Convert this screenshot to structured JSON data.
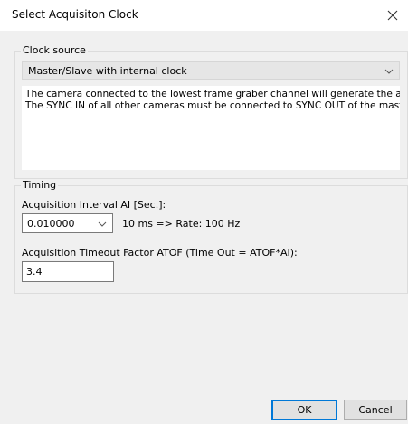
{
  "window": {
    "title": "Select Acquisiton Clock",
    "close_icon": "close-icon"
  },
  "clock_source": {
    "group_label": "Clock source",
    "selected": "Master/Slave with internal clock",
    "description_line1": "The camera connected to the lowest frame graber channel will generate the acquisitic",
    "description_line2": "The SYNC IN of all other cameras must be connected to SYNC OUT of the master cam"
  },
  "timing": {
    "group_label": "Timing",
    "interval_label": "Acquisition Interval AI [Sec.]:",
    "interval_value": "0.010000",
    "rate_text": "10 ms => Rate: 100 Hz",
    "timeout_label": "Acquisition Timeout Factor ATOF (Time Out = ATOF*AI):",
    "timeout_value": "3.4"
  },
  "buttons": {
    "ok": "OK",
    "cancel": "Cancel"
  }
}
